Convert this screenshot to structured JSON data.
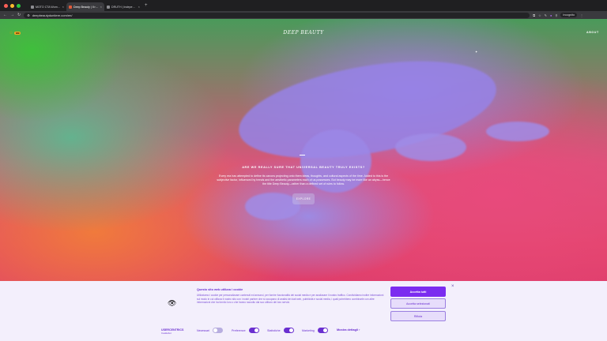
{
  "browser": {
    "tabs": [
      {
        "title": "MOTO CTA Womens Shoes +",
        "active": false,
        "color": "#8d8d92"
      },
      {
        "title": "Deep Beauty | Il rischio del...",
        "active": true,
        "color": "#e25a3a"
      },
      {
        "title": "DRUTH | Independent Studio...",
        "active": false,
        "color": "#8d8d92"
      }
    ],
    "url": "deepbeautyduntiere.com/en/",
    "incognito_label": "Incognito"
  },
  "page": {
    "logo": "DEEP BEAUTY",
    "lang_pill": "EN",
    "about": "ABOUT",
    "headline": "ARE WE REALLY SURE THAT UNIVERSAL BEAUTY TRULY EXISTS?",
    "body": "Every era has attempted to define its canons projecting onto them ideas, thoughts, and cultural aspects of the time. Added to this is the subjective factor, influenced by trends and the aesthetic parameters each of us possesses. But beauty may be more like an abyss—hence the title Deep Beauty—rather than a defined set of rules to follow.",
    "explore": "EXPLORE"
  },
  "cookie": {
    "title": "Questo sito web utilizza i cookie",
    "text": "Utilizziamo i cookie per personalizzare contenuti ed annunci, per fornire funzionalità dei social media e per analizzare il nostro traffico. Condividiamo inoltre informazioni sul modo in cui utilizza il nostro sito con i nostri partner che si occupano di analisi dei dati web, pubblicità e social media, i quali potrebbero combinarle con altre informazioni che ha fornito loro o che hanno raccolto dal suo utilizzo dei loro servizi.",
    "btn_accept_all": "Accetta tutti",
    "btn_accept_selected": "Accetta selezionati",
    "btn_reject": "Rifiuta",
    "brand_name": "USERCENTRICS",
    "brand_sub": "Cookiebot",
    "toggles": [
      {
        "label": "Necessari",
        "on": false
      },
      {
        "label": "Preferenze",
        "on": true
      },
      {
        "label": "Statistiche",
        "on": true
      },
      {
        "label": "Marketing",
        "on": true
      }
    ],
    "details": "Mostra dettagli"
  }
}
